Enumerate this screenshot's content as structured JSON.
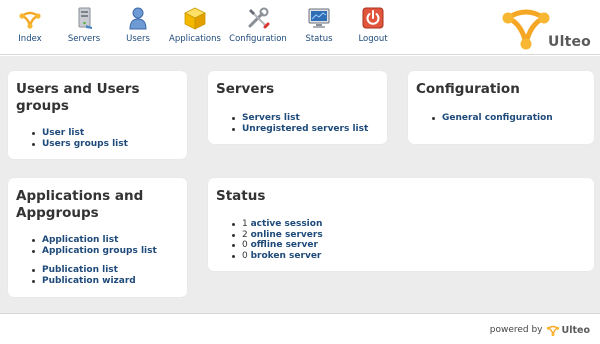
{
  "header": {
    "nav": [
      {
        "label": "Index",
        "icon": "ulteo-index-icon"
      },
      {
        "label": "Servers",
        "icon": "server-icon"
      },
      {
        "label": "Users",
        "icon": "user-icon"
      },
      {
        "label": "Applications",
        "icon": "applications-cube-icon"
      },
      {
        "label": "Configuration",
        "icon": "tools-icon"
      },
      {
        "label": "Status",
        "icon": "monitor-icon"
      },
      {
        "label": "Logout",
        "icon": "power-icon"
      }
    ],
    "logo_text": "Ulteo"
  },
  "cards": {
    "users": {
      "title": "Users and Users groups",
      "links": [
        "User list",
        "Users groups list"
      ]
    },
    "servers": {
      "title": "Servers",
      "links": [
        "Servers list",
        "Unregistered servers list"
      ]
    },
    "configuration": {
      "title": "Configuration",
      "links": [
        "General configuration"
      ]
    },
    "applications": {
      "title": "Applications and Appgroups",
      "links": [
        "Application list",
        "Application groups list"
      ],
      "links2": [
        "Publication list",
        "Publication wizard"
      ]
    },
    "status": {
      "title": "Status",
      "items": [
        {
          "count": "1",
          "link": "active session"
        },
        {
          "count": "2",
          "link": "online servers"
        },
        {
          "count": "0",
          "link": "offline server"
        },
        {
          "count": "0",
          "link": "broken server"
        }
      ]
    }
  },
  "footer": {
    "powered_by": "powered by",
    "brand": "Ulteo"
  },
  "colors": {
    "link": "#1e4a7a",
    "brand_orange": "#f5a623",
    "background": "#ececec"
  }
}
